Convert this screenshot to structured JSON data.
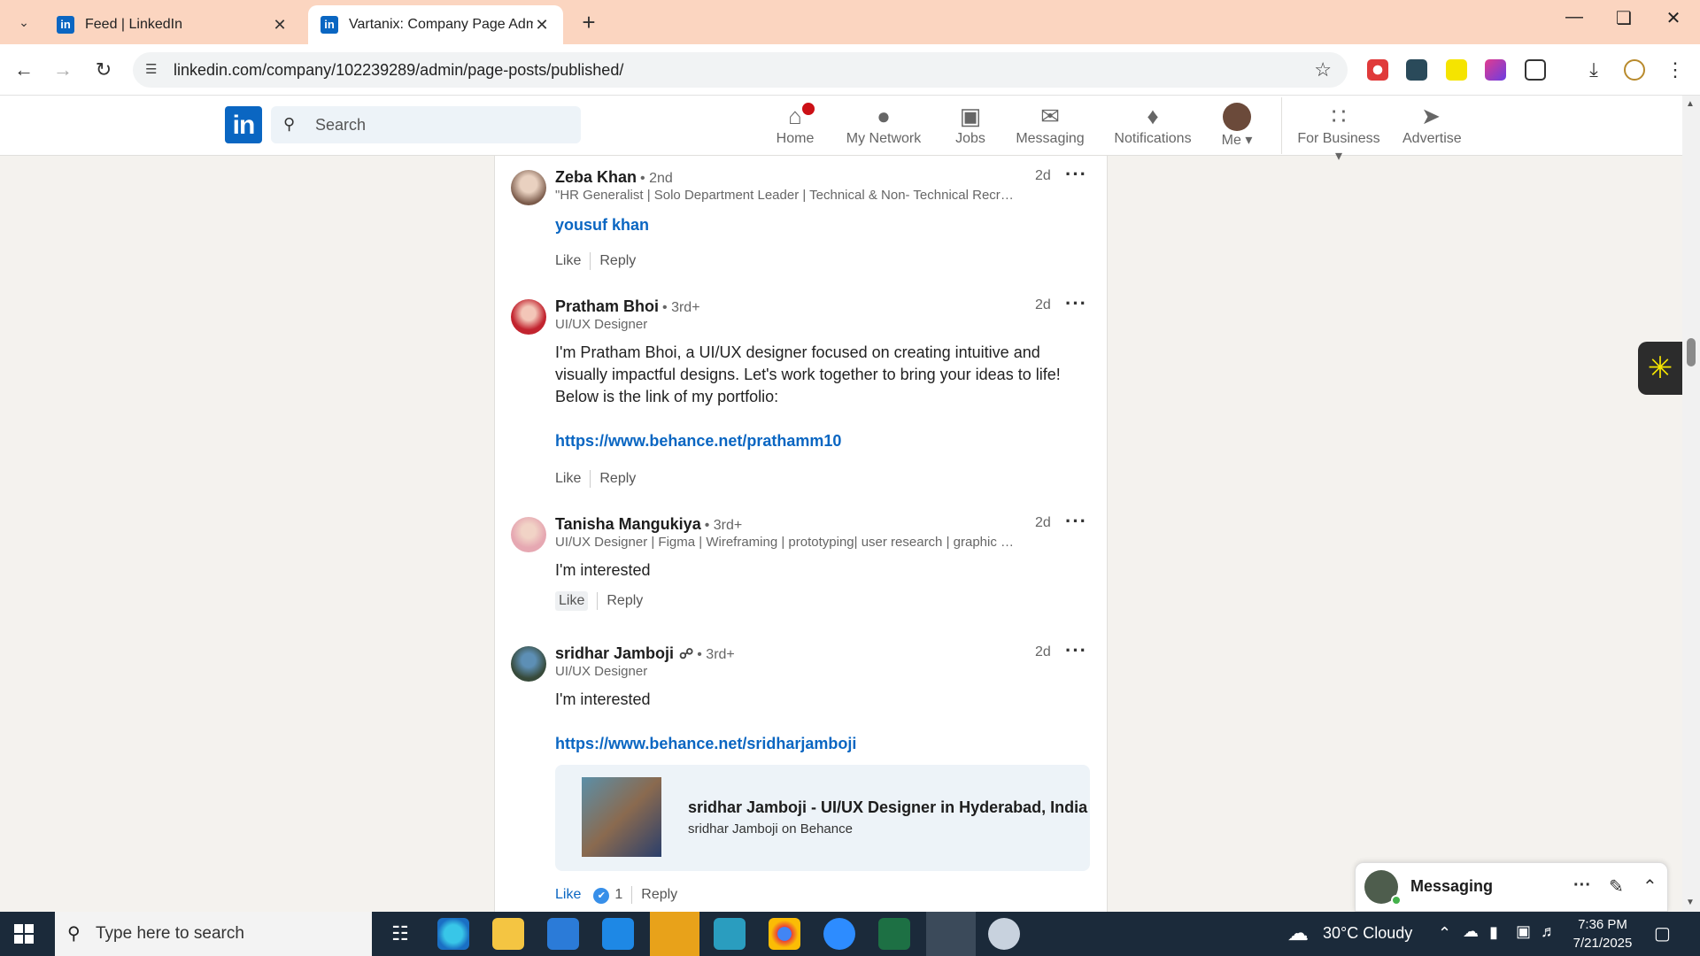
{
  "browser": {
    "tabs": [
      {
        "title": "Feed | LinkedIn",
        "active": false
      },
      {
        "title": "Vartanix: Company Page Admin",
        "active": false
      }
    ],
    "url": "linkedin.com/company/102239289/admin/page-posts/published/"
  },
  "linkedin": {
    "search_placeholder": "Search",
    "nav": {
      "home": "Home",
      "network": "My Network",
      "jobs": "Jobs",
      "messaging": "Messaging",
      "notifications": "Notifications",
      "me": "Me",
      "business": "For Business",
      "advertise": "Advertise"
    }
  },
  "comments": [
    {
      "name": "Zeba Khan",
      "degree": "• 2nd",
      "headline": "\"HR Generalist | Solo Department Leader | Technical & Non- Technical Recruit...",
      "time": "2d",
      "mention": "yousuf khan",
      "like": "Like",
      "reply": "Reply"
    },
    {
      "name": "Pratham Bhoi",
      "degree": "• 3rd+",
      "headline": "UI/UX Designer",
      "time": "2d",
      "body": "I'm Pratham Bhoi, a UI/UX designer focused on creating intuitive and visually impactful designs. Let's work together to bring your ideas to life! Below is the link of my portfolio:",
      "link": "https://www.behance.net/prathamm10",
      "like": "Like",
      "reply": "Reply"
    },
    {
      "name": "Tanisha Mangukiya",
      "degree": "• 3rd+",
      "headline": "UI/UX Designer | Figma | Wireframing | prototyping| user research | graphic d...",
      "time": "2d",
      "body": "I'm interested",
      "like": "Like",
      "reply": "Reply"
    },
    {
      "name": "sridhar Jamboji",
      "degree": "• 3rd+",
      "headline": "UI/UX Designer",
      "time": "2d",
      "body": "I'm interested",
      "link": "https://www.behance.net/sridharjamboji",
      "preview_title": "sridhar Jamboji - UI/UX Designer in Hyderabad, India",
      "preview_sub": "sridhar Jamboji on Behance",
      "like": "Like",
      "reaction_count": "1",
      "reply": "Reply"
    }
  ],
  "messaging": {
    "title": "Messaging"
  },
  "taskbar": {
    "search_placeholder": "Type here to search",
    "weather": "30°C  Cloudy",
    "time": "7:36 PM",
    "date": "7/21/2025"
  },
  "colors": {
    "linkedin_blue": "#0a66c2",
    "tab_strip": "#fbd5c0"
  }
}
